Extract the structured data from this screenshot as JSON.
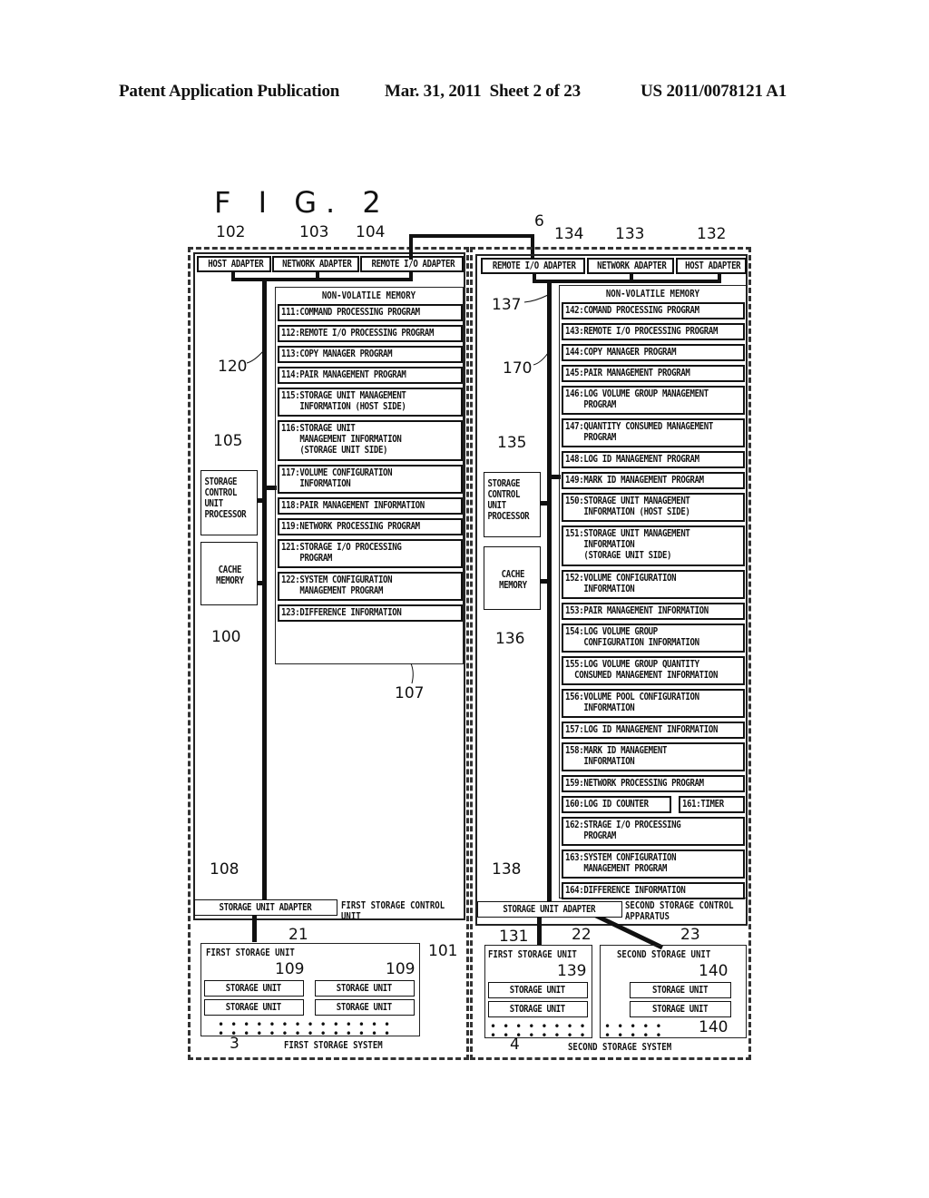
{
  "header": {
    "publication": "Patent Application Publication",
    "date_sheet": "Mar. 31, 2011  Sheet 2 of 23",
    "patent_number": "US 2011/0078121 A1"
  },
  "figure": {
    "title": "F I G. 2"
  },
  "left": {
    "refs": {
      "host_adapter": "102",
      "network_adapter": "103",
      "remote_io_adapter": "104",
      "bus": "120",
      "processor": "105",
      "cache": "100",
      "memory": "107",
      "storage_adapter": "108",
      "control_unit": "101",
      "storage_unit_group": "21",
      "storage_unit_a": "109",
      "storage_unit_b": "109",
      "system": "3"
    },
    "adapters": {
      "host": "HOST ADAPTER",
      "network": "NETWORK ADAPTER",
      "remote": "REMOTE I/O ADAPTER"
    },
    "processor": "STORAGE\nCONTROL\nUNIT\nPROCESSOR",
    "cache": "CACHE\nMEMORY",
    "memory_title": "NON-VOLATILE MEMORY",
    "memory_items": [
      "111:COMMAND PROCESSING PROGRAM",
      "112:REMOTE I/O PROCESSING PROGRAM",
      "113:COPY MANAGER PROGRAM",
      "114:PAIR MANAGEMENT PROGRAM",
      "115:STORAGE UNIT MANAGEMENT\n    INFORMATION (HOST SIDE)",
      "116:STORAGE UNIT\n    MANAGEMENT INFORMATION\n    (STORAGE UNIT SIDE)",
      "117:VOLUME CONFIGURATION\n    INFORMATION",
      "118:PAIR MANAGEMENT INFORMATION",
      "119:NETWORK PROCESSING PROGRAM",
      "121:STORAGE I/O PROCESSING\n    PROGRAM",
      "122:SYSTEM CONFIGURATION\n    MANAGEMENT PROGRAM",
      "123:DIFFERENCE INFORMATION"
    ],
    "storage_adapter": "STORAGE UNIT ADAPTER",
    "control_unit_label": "FIRST STORAGE CONTROL\nUNIT",
    "storage_unit_group_label": "FIRST STORAGE UNIT",
    "storage_unit": "STORAGE UNIT",
    "system_label": "FIRST STORAGE SYSTEM"
  },
  "right": {
    "refs": {
      "link": "6",
      "remote_io_adapter": "134",
      "network_adapter": "133",
      "host_adapter": "132",
      "bus_a": "137",
      "bus_b": "170",
      "processor": "135",
      "cache": "136",
      "storage_adapter": "138",
      "control_unit": "131",
      "first_unit_group": "22",
      "second_unit_group": "23",
      "first_unit": "139",
      "second_unit_a": "140",
      "second_unit_b": "140",
      "system": "4"
    },
    "adapters": {
      "remote": "REMOTE I/O ADAPTER",
      "network": "NETWORK ADAPTER",
      "host": "HOST ADAPTER"
    },
    "processor": "STORAGE\nCONTROL\nUNIT\nPROCESSOR",
    "cache": "CACHE\nMEMORY",
    "memory_title": "NON-VOLATILE MEMORY",
    "memory_items": [
      "142:COMAND PROCESSING PROGRAM",
      "143:REMOTE I/O PROCESSING PROGRAM",
      "144:COPY MANAGER PROGRAM",
      "145:PAIR MANAGEMENT PROGRAM",
      "146:LOG VOLUME GROUP MANAGEMENT\n    PROGRAM",
      "147:QUANTITY CONSUMED MANAGEMENT\n    PROGRAM",
      "148:LOG ID MANAGEMENT PROGRAM",
      "149:MARK ID MANAGEMENT PROGRAM",
      "150:STORAGE UNIT MANAGEMENT\n    INFORMATION (HOST SIDE)",
      "151:STORAGE UNIT MANAGEMENT\n    INFORMATION\n    (STORAGE UNIT SIDE)",
      "152:VOLUME CONFIGURATION\n    INFORMATION",
      "153:PAIR MANAGEMENT INFORMATION",
      "154:LOG VOLUME GROUP\n    CONFIGURATION INFORMATION",
      "155:LOG VOLUME GROUP QUANTITY\n  CONSUMED MANAGEMENT INFORMATION",
      "156:VOLUME POOL CONFIGURATION\n    INFORMATION",
      "157:LOG ID MANAGEMENT INFORMATION",
      "158:MARK ID MANAGEMENT\n    INFORMATION",
      "159:NETWORK PROCESSING PROGRAM",
      "160:LOG ID COUNTER",
      "161:TIMER",
      "162:STRAGE I/O PROCESSING\n    PROGRAM",
      "163:SYSTEM CONFIGURATION\n    MANAGEMENT PROGRAM",
      "164:DIFFERENCE INFORMATION"
    ],
    "storage_adapter": "STORAGE UNIT ADAPTER",
    "control_unit_label": "SECOND STORAGE CONTROL\nAPPARATUS",
    "first_unit_group_label": "FIRST STORAGE UNIT",
    "second_unit_group_label": "SECOND STORAGE UNIT",
    "storage_unit": "STORAGE UNIT",
    "system_label": "SECOND STORAGE SYSTEM"
  }
}
